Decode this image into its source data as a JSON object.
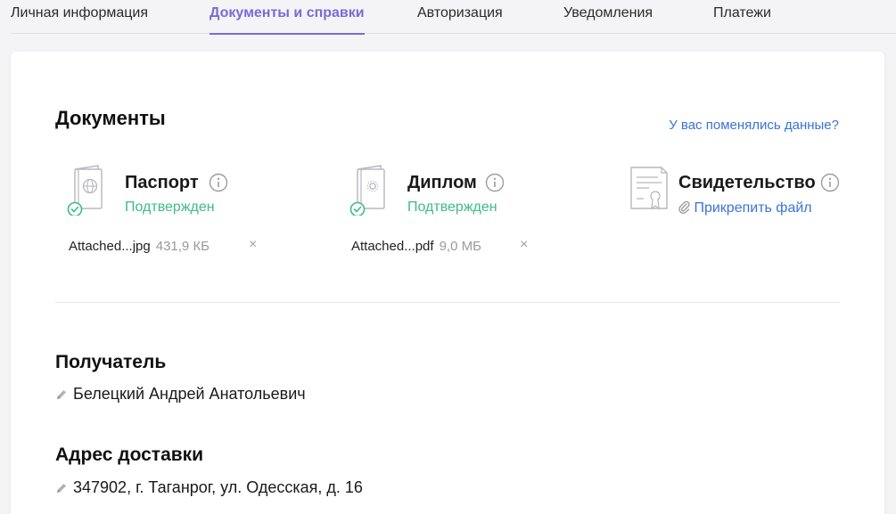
{
  "tabs": [
    {
      "label": "Личная информация"
    },
    {
      "label": "Документы и справки"
    },
    {
      "label": "Авторизация"
    },
    {
      "label": "Уведомления"
    },
    {
      "label": "Платежи"
    }
  ],
  "documents": {
    "title": "Документы",
    "changed_link": "У вас поменялись данные?",
    "items": [
      {
        "title": "Паспорт",
        "status": "Подтвержден",
        "file_name": "Attached...jpg",
        "file_size": "431,9 КБ",
        "remove": "×",
        "icon": "passport-icon"
      },
      {
        "title": "Диплом",
        "status": "Подтвержден",
        "file_name": "Attached...pdf",
        "file_size": "9,0 МБ",
        "remove": "×",
        "icon": "diploma-icon"
      },
      {
        "title": "Свидетельство",
        "attach_label": "Прикрепить файл",
        "icon": "certificate-icon"
      }
    ]
  },
  "recipient": {
    "title": "Получатель",
    "value": "Белецкий Андрей Анатольевич"
  },
  "address": {
    "title": "Адрес доставки",
    "value": "347902, г. Таганрог, ул. Одесская, д. 16"
  },
  "colors": {
    "accent": "#7a6ad8",
    "link": "#3a73d6",
    "success": "#3dbb86"
  }
}
